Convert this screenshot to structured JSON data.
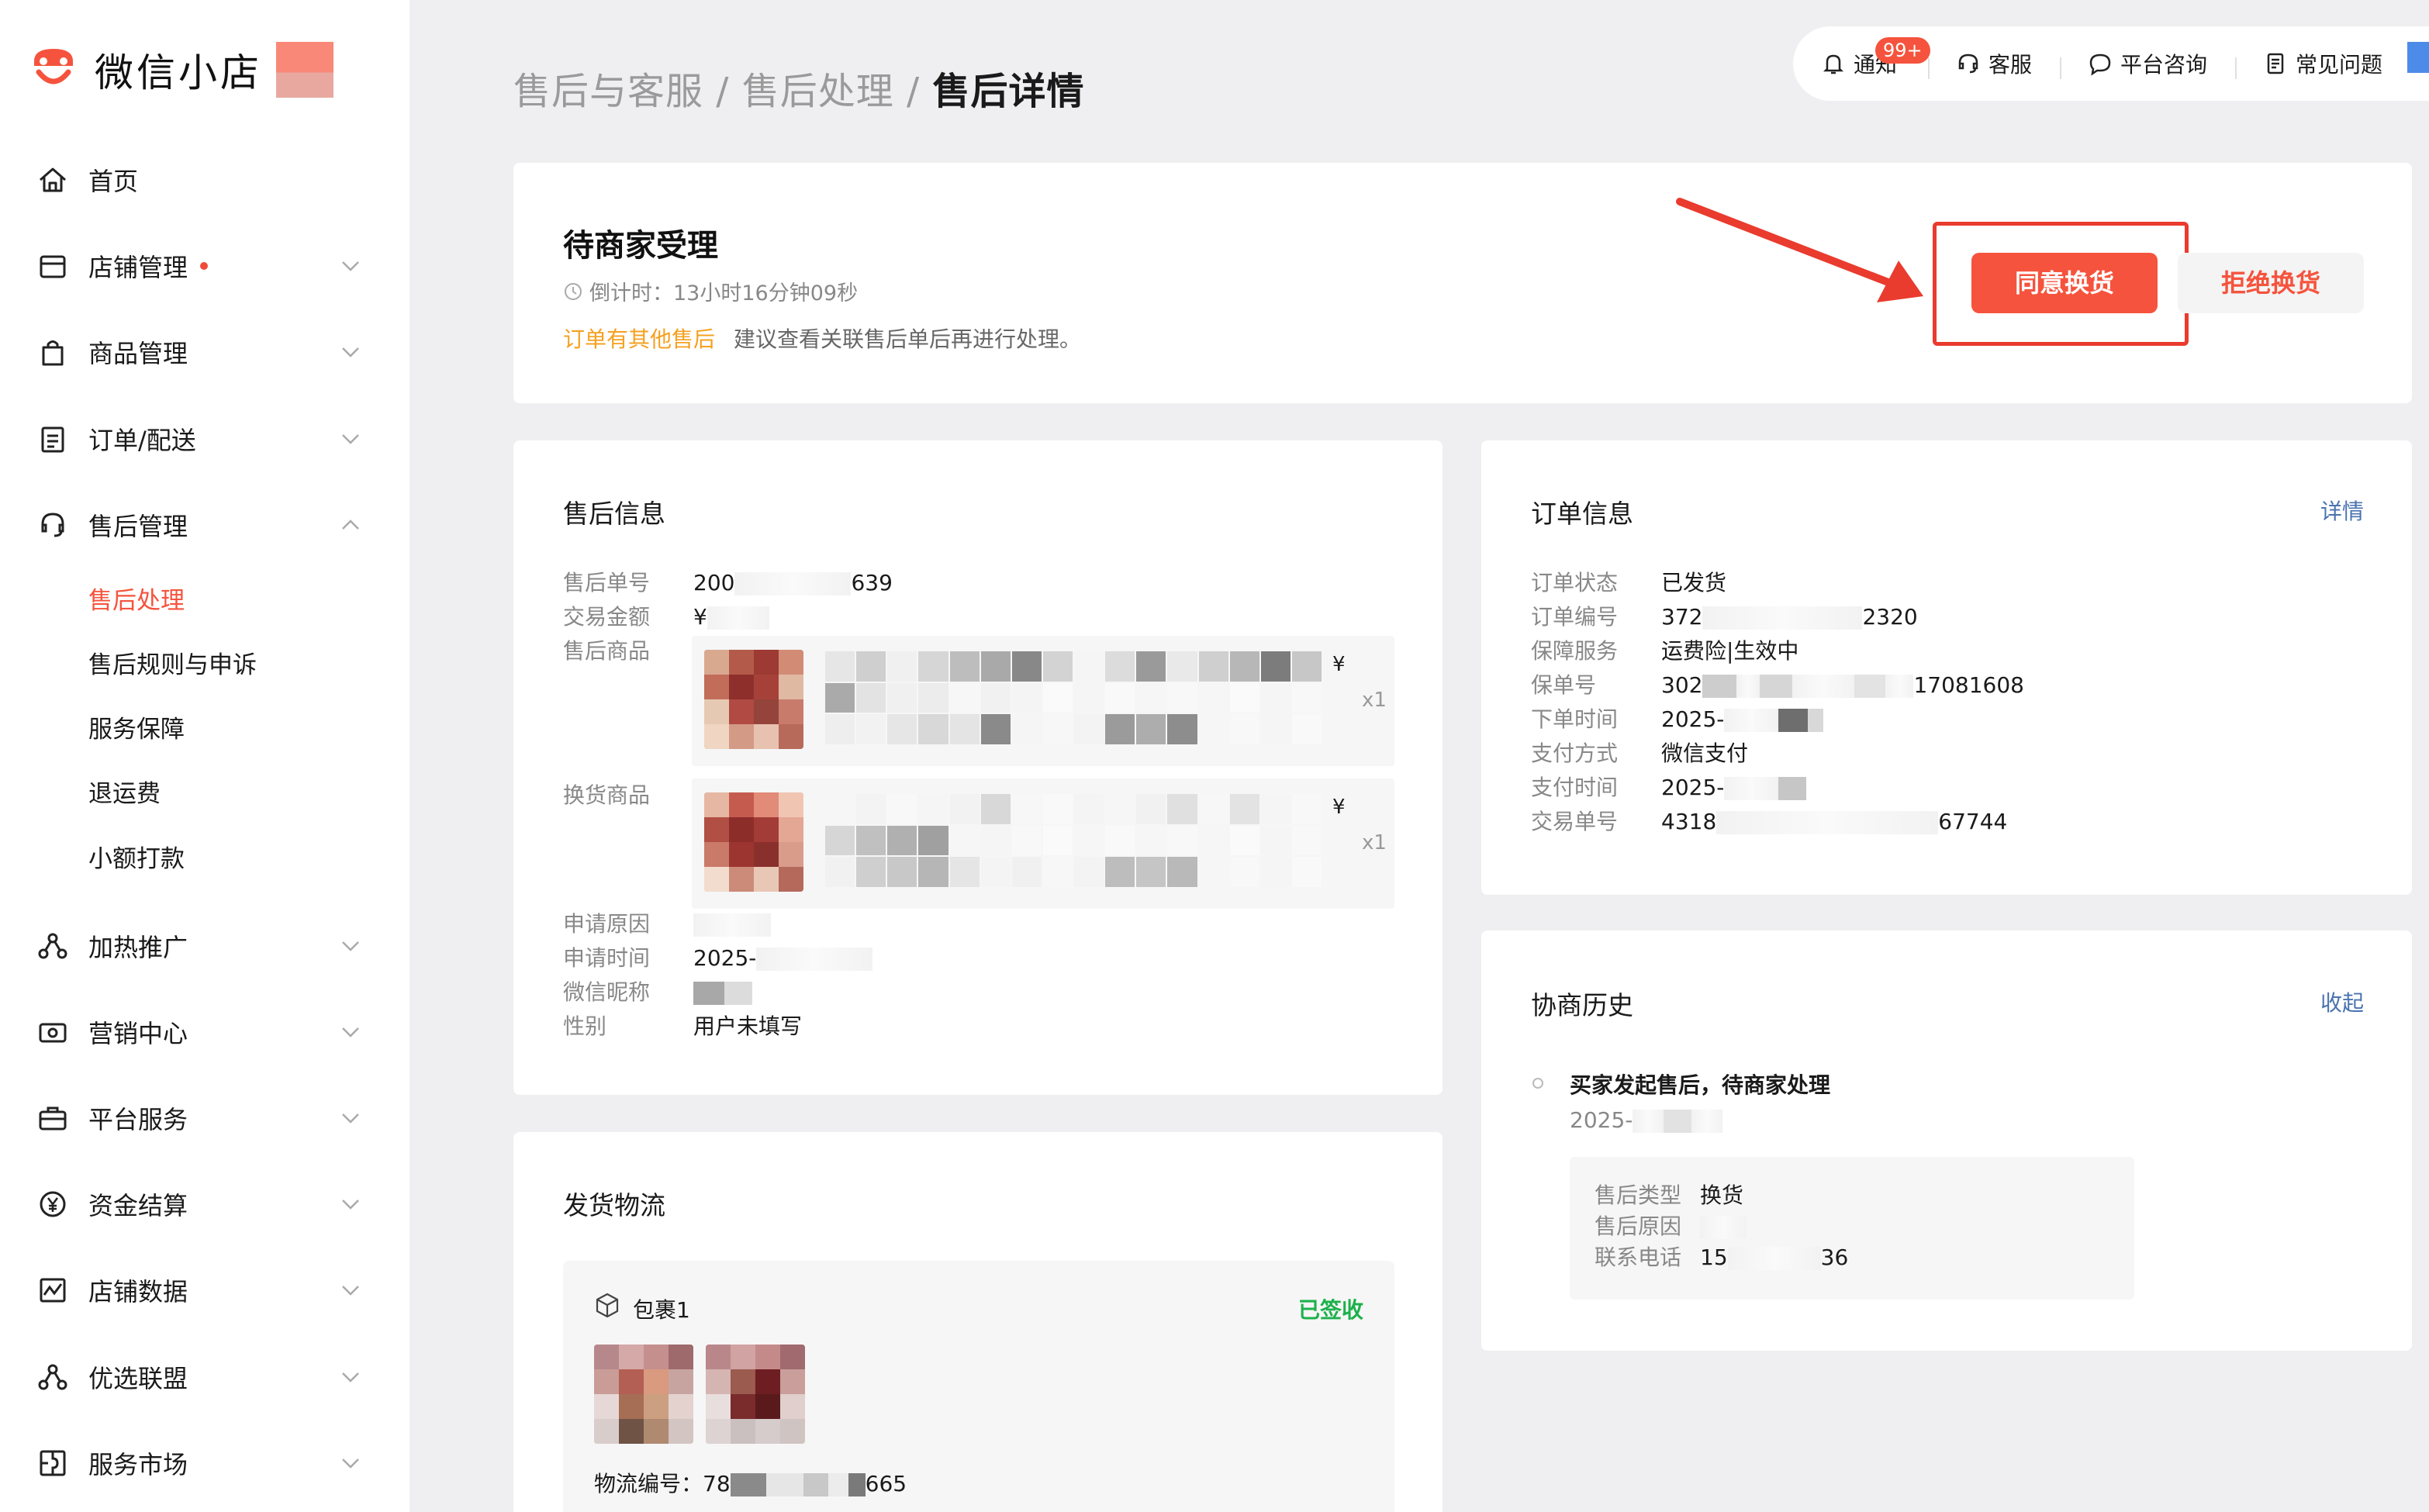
{
  "app": {
    "brand": "微信小店"
  },
  "sidebar": {
    "items": [
      {
        "label": "首页",
        "icon": "home-icon"
      },
      {
        "label": "店铺管理",
        "icon": "store-icon",
        "dot": true
      },
      {
        "label": "商品管理",
        "icon": "bag-icon"
      },
      {
        "label": "订单/配送",
        "icon": "order-icon"
      },
      {
        "label": "售后管理",
        "icon": "headset-icon",
        "expanded": true
      },
      {
        "label": "加热推广",
        "icon": "promote-icon"
      },
      {
        "label": "营销中心",
        "icon": "coupon-icon"
      },
      {
        "label": "平台服务",
        "icon": "briefcase-icon"
      },
      {
        "label": "资金结算",
        "icon": "yen-icon"
      },
      {
        "label": "店铺数据",
        "icon": "chart-icon"
      },
      {
        "label": "优选联盟",
        "icon": "network-icon"
      },
      {
        "label": "服务市场",
        "icon": "puzzle-icon"
      }
    ],
    "sub_items": [
      {
        "label": "售后处理",
        "active": true
      },
      {
        "label": "售后规则与申诉",
        "active": false
      },
      {
        "label": "服务保障",
        "active": false
      },
      {
        "label": "退运费",
        "active": false
      },
      {
        "label": "小额打款",
        "active": false
      }
    ]
  },
  "breadcrumb": {
    "part1": "售后与客服",
    "sep": "/",
    "part2": "售后处理",
    "current": "售后详情"
  },
  "topbar": {
    "notify": "通知",
    "badge": "99+",
    "service": "客服",
    "consult": "平台咨询",
    "faq": "常见问题"
  },
  "status": {
    "title": "待商家受理",
    "countdown": "倒计时：13小时16分钟09秒",
    "warn": "订单有其他售后",
    "hint": "建议查看关联售后单后再进行处理。",
    "agree_label": "同意换货",
    "reject_label": "拒绝换货"
  },
  "aftersale": {
    "title": "售后信息",
    "order_no_label": "售后单号",
    "order_no_a": "200",
    "order_no_b": "639",
    "amount_label": "交易金额",
    "amount": "¥",
    "goods_label": "售后商品",
    "goods_price": "¥",
    "goods_qty": "x1",
    "exchange_label": "换货商品",
    "exchange_price": "¥",
    "exchange_qty": "x1",
    "reason_label": "申请原因",
    "time_label": "申请时间",
    "time": "2025-",
    "nick_label": "微信昵称",
    "gender_label": "性别",
    "gender": "用户未填写"
  },
  "order": {
    "title": "订单信息",
    "detail_link": "详情",
    "rows": [
      {
        "k": "订单状态",
        "v": "已发货",
        "tail": ""
      },
      {
        "k": "订单编号",
        "v": "372",
        "tail": "2320"
      },
      {
        "k": "保障服务",
        "v": "运费险|生效中",
        "tail": ""
      },
      {
        "k": "保单号",
        "v": "302",
        "tail": "17081608"
      },
      {
        "k": "下单时间",
        "v": "2025-",
        "tail": ""
      },
      {
        "k": "支付方式",
        "v": "微信支付",
        "tail": ""
      },
      {
        "k": "支付时间",
        "v": "2025-",
        "tail": ""
      },
      {
        "k": "交易单号",
        "v": "4318",
        "tail": "67744"
      }
    ]
  },
  "history": {
    "title": "协商历史",
    "collapse_link": "收起",
    "event": "买家发起售后，待商家处理",
    "time": "2025-",
    "type_label": "售后类型",
    "type": "换货",
    "reason_label": "售后原因",
    "phone_label": "联系电话",
    "phone_a": "15",
    "phone_b": "36"
  },
  "logistics": {
    "title": "发货物流",
    "package": "包裹1",
    "status": "已签收",
    "no_label": "物流编号：78",
    "no_tail": "665"
  },
  "colors": {
    "accent": "#f5533d",
    "warn": "#f5a020",
    "link": "#4a73b0",
    "success": "#1db14b",
    "highlight": "#e93b2e"
  }
}
